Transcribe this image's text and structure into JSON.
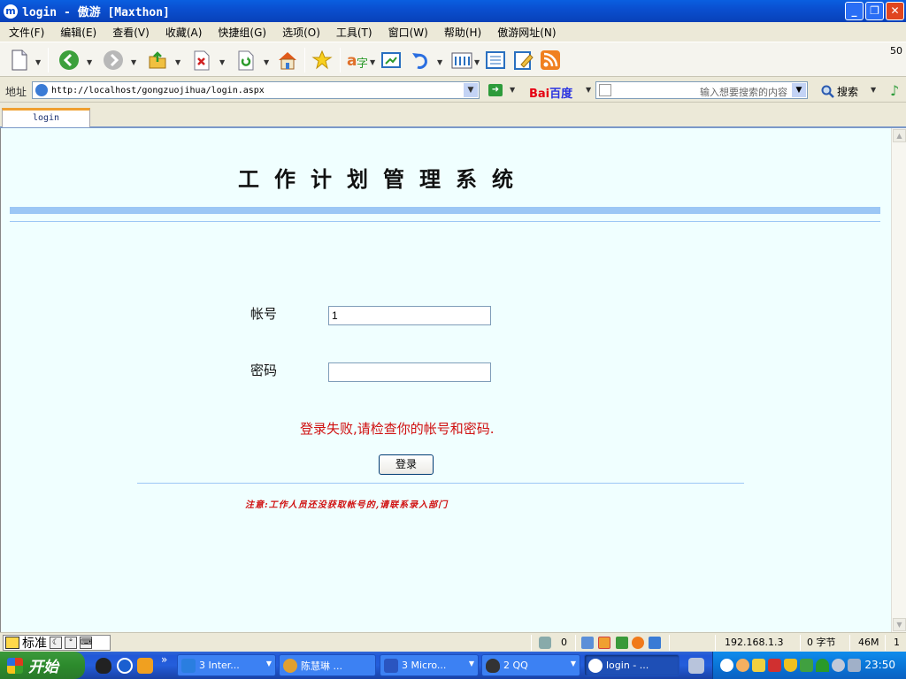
{
  "window": {
    "title": "login - 傲游 [Maxthon]",
    "logo_letter": "m",
    "min_glyph": "_",
    "restore_glyph": "❐",
    "close_glyph": "✕"
  },
  "menu": [
    "文件(F)",
    "编辑(E)",
    "查看(V)",
    "收藏(A)",
    "快捷组(G)",
    "选项(O)",
    "工具(T)",
    "窗口(W)",
    "帮助(H)",
    "傲游网址(N)"
  ],
  "toolbar": {
    "right_number": "50"
  },
  "address": {
    "label": "地址",
    "url": "http://localhost/gongzuojihua/login.aspx",
    "go_glyph": "➜"
  },
  "search": {
    "baidu_bai": "Bai",
    "baidu_du": "百度",
    "placeholder": "输入想要搜索的内容",
    "button_label": "搜索"
  },
  "tabs": [
    {
      "label": "login",
      "active": true
    }
  ],
  "page": {
    "system_title": "工作计划管理系统",
    "account_label": "帐号",
    "account_value": "1",
    "password_label": "密码",
    "password_value": "",
    "error_message": "登录失败,请检查你的帐号和密码.",
    "login_button": "登录",
    "notice": "注意:工作人员还没获取帐号的,请联系录入部门"
  },
  "statusbar": {
    "ime_text": "标准",
    "trash_count": "0",
    "ip": "192.168.1.3",
    "bytes": "0 字节",
    "memory": "46M",
    "tab_count": "1"
  },
  "taskbar": {
    "start_label": "开始",
    "overflow_glyph": "»",
    "tasks": [
      {
        "label": "3 Inter...",
        "icon_color": "#2a7ee0"
      },
      {
        "label": "陈慧琳 ...",
        "icon_color": "#e0a030"
      },
      {
        "label": "3 Micro...",
        "icon_color": "#2a55c0"
      },
      {
        "label": "2 QQ",
        "icon_color": "#333333"
      },
      {
        "label": "login - ...",
        "icon_color": "#ffffff"
      }
    ],
    "clock": "23:50"
  },
  "colors": {
    "accent_band": "#9cc7f5",
    "page_bg": "#f0ffff",
    "error": "#d01010"
  }
}
